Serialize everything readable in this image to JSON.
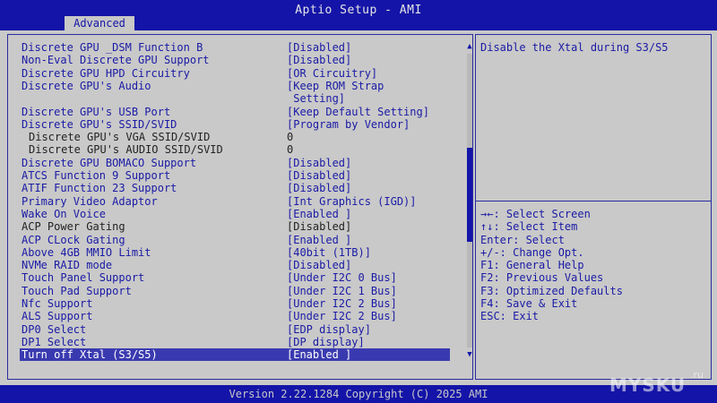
{
  "app": {
    "title": "Aptio Setup - AMI"
  },
  "tabs": [
    {
      "label": "Advanced",
      "active": true
    }
  ],
  "settings": [
    {
      "label": "Discrete GPU _DSM Function B",
      "value": "[Disabled]"
    },
    {
      "label": "Non-Eval Discrete GPU Support",
      "value": "[Disabled]"
    },
    {
      "label": "Discrete GPU HPD Circuitry",
      "value": "[OR Circuitry]"
    },
    {
      "label": "Discrete GPU's Audio",
      "value": "[Keep ROM Strap"
    },
    {
      "label": "",
      "value": " Setting]"
    },
    {
      "label": "Discrete GPU's USB Port",
      "value": "[Keep Default Setting]"
    },
    {
      "label": "Discrete GPU's SSID/SVID",
      "value": "[Program by Vendor]"
    },
    {
      "label": "Discrete GPU's VGA SSID/SVID",
      "value": "0"
    },
    {
      "label": "Discrete GPU's AUDIO SSID/SVID",
      "value": "0"
    },
    {
      "label": "Discrete GPU BOMACO Support",
      "value": "[Disabled]"
    },
    {
      "label": "ATCS Function 9 Support",
      "value": "[Disabled]"
    },
    {
      "label": "ATIF Function 23 Support",
      "value": "[Disabled]"
    },
    {
      "label": "Primary Video Adaptor",
      "value": "[Int Graphics (IGD)]"
    },
    {
      "label": "Wake On Voice",
      "value": "[Enabled ]"
    },
    {
      "label": "ACP Power Gating",
      "value": "[Disabled]"
    },
    {
      "label": "ACP CLock Gating",
      "value": "[Enabled ]"
    },
    {
      "label": "Above 4GB MMIO Limit",
      "value": "[40bit (1TB)]"
    },
    {
      "label": "NVMe RAID mode",
      "value": "[Disabled]"
    },
    {
      "label": "Touch Panel Support",
      "value": "[Under I2C 0 Bus]"
    },
    {
      "label": "Touch Pad Support",
      "value": "[Under I2C 1 Bus]"
    },
    {
      "label": "Nfc Support",
      "value": "[Under I2C 2 Bus]"
    },
    {
      "label": "ALS Support",
      "value": "[Under I2C 2 Bus]"
    },
    {
      "label": "DP0 Select",
      "value": "[EDP display]"
    },
    {
      "label": "DP1 Select",
      "value": "[DP display]"
    },
    {
      "label": "Turn off Xtal (S3/S5)",
      "value": "[Enabled ]"
    }
  ],
  "selected_index": 24,
  "scroll": {
    "thumb_start_fraction": 0.32,
    "thumb_end_fraction": 0.64
  },
  "help": {
    "description": "Disable the Xtal during S3/S5"
  },
  "keys": [
    "→←: Select Screen",
    "↑↓: Select Item",
    "Enter: Select",
    "+/-: Change Opt.",
    "F1: General Help",
    "F2: Previous Values",
    "F3: Optimized Defaults",
    "F4: Save & Exit",
    "ESC: Exit"
  ],
  "footer": {
    "version": "Version 2.22.1284 Copyright (C) 2025 AMI"
  },
  "watermark": {
    "text": "MYSKU",
    "suffix": ".ru"
  },
  "colors": {
    "header_bg": "#1414a8",
    "screen_bg": "#c9c9c9",
    "text_blue": "#1a1aa6",
    "selected_text": "#ffffff"
  }
}
